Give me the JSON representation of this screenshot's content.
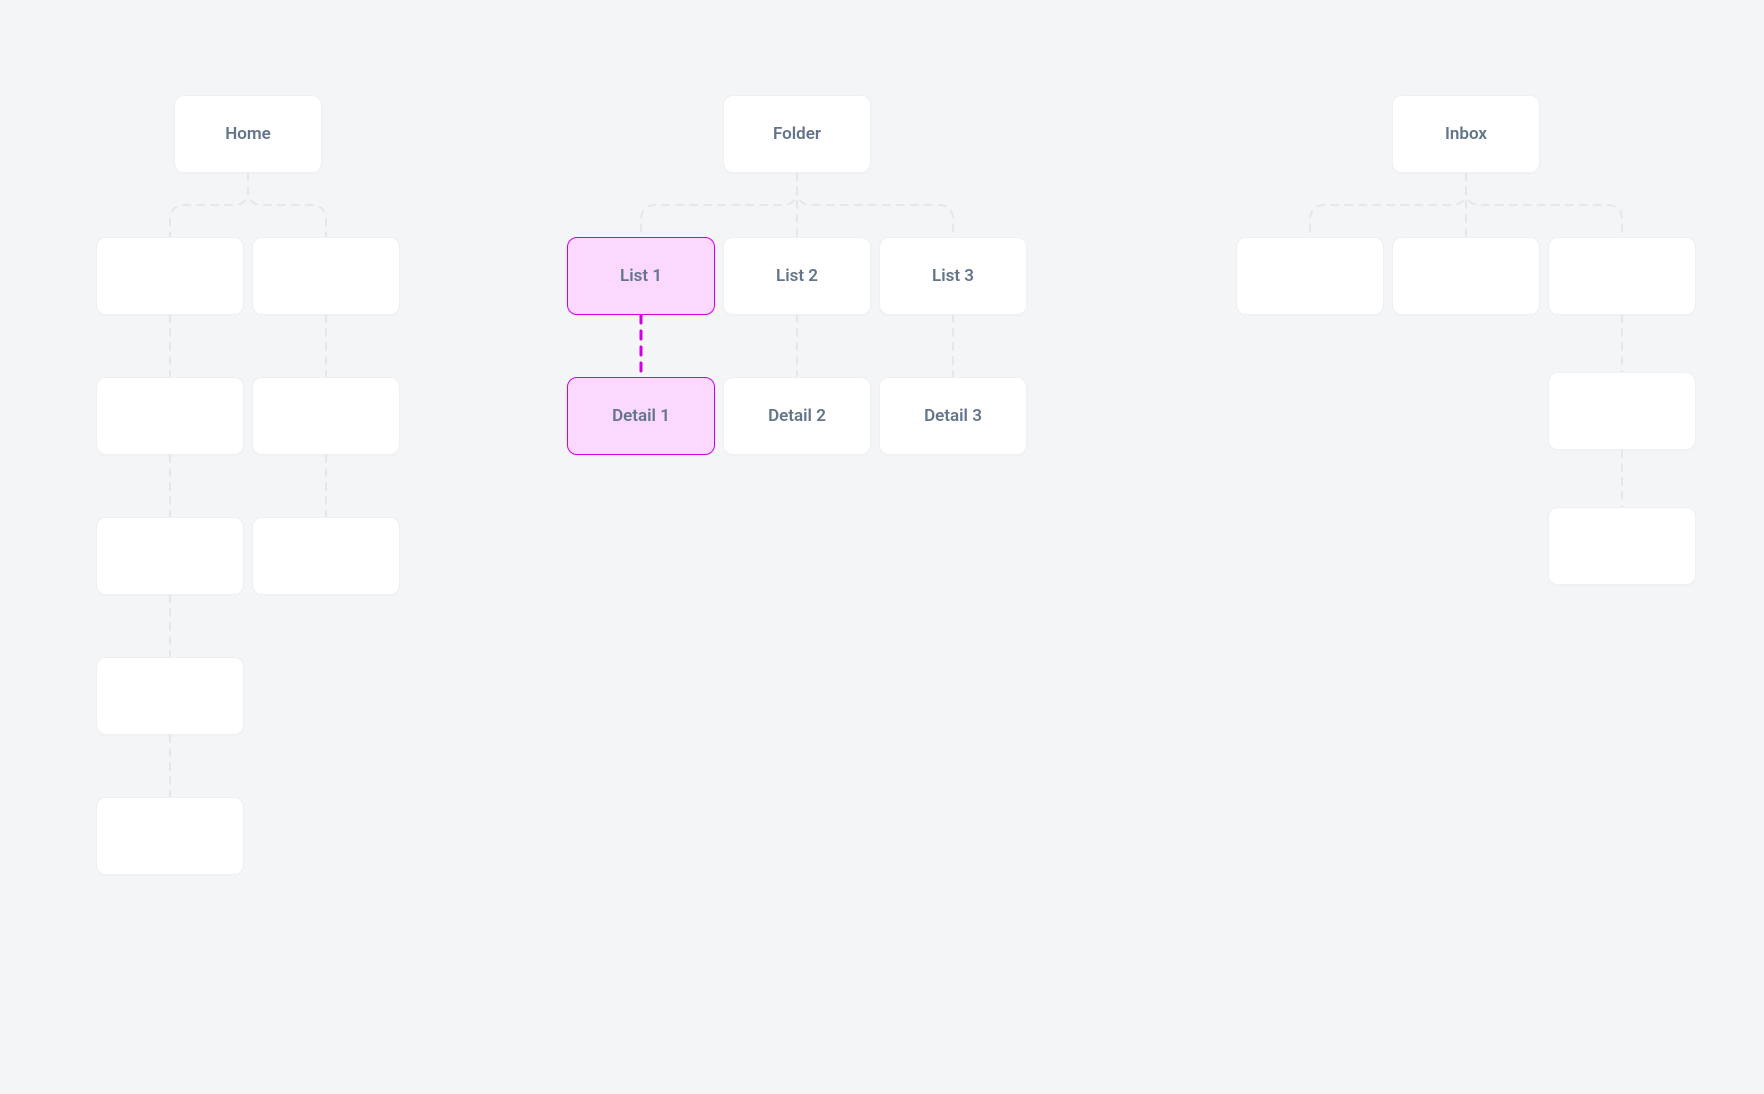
{
  "nodes": {
    "home": {
      "label": "Home"
    },
    "folder": {
      "label": "Folder"
    },
    "inbox": {
      "label": "Inbox"
    },
    "list1": {
      "label": "List 1"
    },
    "list2": {
      "label": "List 2"
    },
    "list3": {
      "label": "List 3"
    },
    "detail1": {
      "label": "Detail 1"
    },
    "detail2": {
      "label": "Detail 2"
    },
    "detail3": {
      "label": "Detail 3"
    },
    "h_a1": {
      "label": ""
    },
    "h_a2": {
      "label": ""
    },
    "h_b1": {
      "label": ""
    },
    "h_b2": {
      "label": ""
    },
    "h_c1": {
      "label": ""
    },
    "h_c2": {
      "label": ""
    },
    "h_d1": {
      "label": ""
    },
    "h_e1": {
      "label": ""
    },
    "i_a1": {
      "label": ""
    },
    "i_a2": {
      "label": ""
    },
    "i_a3": {
      "label": ""
    },
    "i_b": {
      "label": ""
    },
    "i_c": {
      "label": ""
    }
  }
}
